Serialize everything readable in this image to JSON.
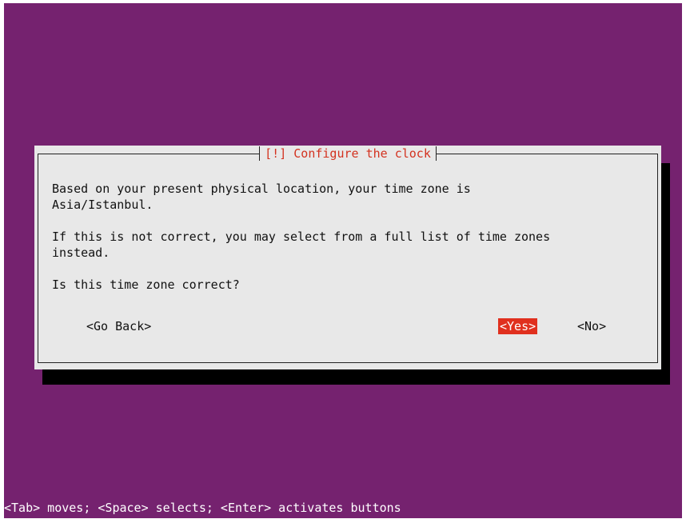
{
  "dialog": {
    "title": "[!] Configure the clock",
    "paragraph1": "Based on your present physical location, your time zone is\nAsia/Istanbul.",
    "paragraph2": "If this is not correct, you may select from a full list of time zones\ninstead.",
    "question": "Is this time zone correct?",
    "buttons": {
      "go_back": "<Go Back>",
      "yes": "<Yes>",
      "no": "<No>"
    },
    "selected_button": "yes"
  },
  "status_bar": {
    "hint": "<Tab> moves; <Space> selects; <Enter> activates buttons"
  },
  "colors": {
    "background": "#75226f",
    "dialog": "#e8e8e8",
    "title_text": "#d3321f",
    "selected_button": "#e0301e",
    "shadow": "#000000"
  }
}
